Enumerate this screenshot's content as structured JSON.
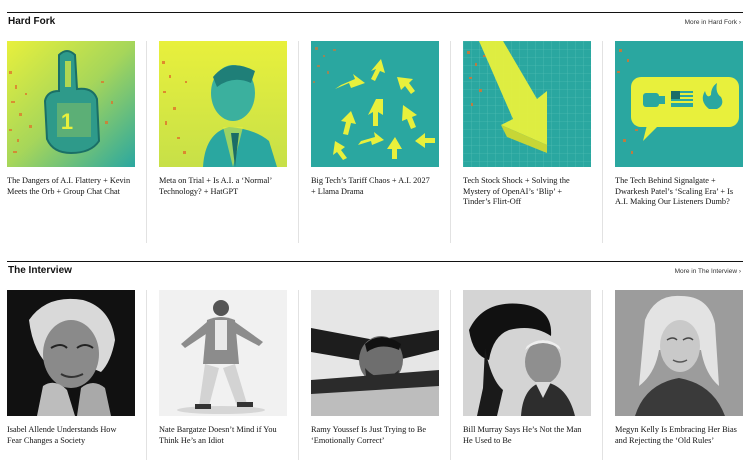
{
  "sections": [
    {
      "title": "Hard Fork",
      "more_link": "More in Hard Fork ›",
      "cards": [
        {
          "headline": "The Dangers of A.I. Flattery + Kevin Meets the Orb + Group Chat Chat"
        },
        {
          "headline": "Meta on Trial + Is A.I. a ‘Normal’ Technology? + HatGPT"
        },
        {
          "headline": "Big Tech’s Tariff Chaos + A.I. 2027 + Llama Drama"
        },
        {
          "headline": "Tech Stock Shock + Solving the Mystery of OpenAI’s ‘Blip’ + Tinder’s Flirt-Off"
        },
        {
          "headline": "The Tech Behind Signalgate + Dwarkesh Patel’s ‘Scaling Era’ + Is A.I. Making Our Listeners Dumb?"
        }
      ]
    },
    {
      "title": "The Interview",
      "more_link": "More in The Interview ›",
      "cards": [
        {
          "headline": "Isabel Allende Understands How Fear Changes a Society"
        },
        {
          "headline": "Nate Bargatze Doesn’t Mind if You Think He’s an Idiot"
        },
        {
          "headline": "Ramy Youssef Is Just Trying to Be ‘Emotionally Correct’"
        },
        {
          "headline": "Bill Murray Says He’s Not the Man He Used to Be"
        },
        {
          "headline": "Megyn Kelly Is Embracing Her Bias and Rejecting the ‘Old Rules’"
        }
      ]
    }
  ],
  "colors": {
    "hardfork_yellow": "#e8f03c",
    "hardfork_teal": "#2aa7a0"
  }
}
